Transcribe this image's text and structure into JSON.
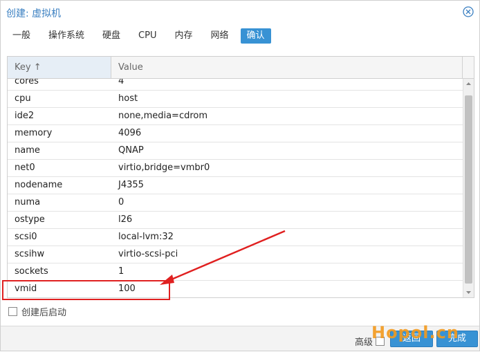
{
  "window": {
    "title": "创建: 虚拟机"
  },
  "tabs": [
    {
      "label": "一般"
    },
    {
      "label": "操作系统"
    },
    {
      "label": "硬盘"
    },
    {
      "label": "CPU"
    },
    {
      "label": "内存"
    },
    {
      "label": "网络"
    },
    {
      "label": "确认",
      "active": true
    }
  ],
  "grid": {
    "columns": {
      "key": "Key ↑",
      "value": "Value"
    },
    "rows": [
      {
        "key": "cores",
        "value": "4"
      },
      {
        "key": "cpu",
        "value": "host"
      },
      {
        "key": "ide2",
        "value": "none,media=cdrom"
      },
      {
        "key": "memory",
        "value": "4096"
      },
      {
        "key": "name",
        "value": "QNAP"
      },
      {
        "key": "net0",
        "value": "virtio,bridge=vmbr0"
      },
      {
        "key": "nodename",
        "value": "J4355"
      },
      {
        "key": "numa",
        "value": "0"
      },
      {
        "key": "ostype",
        "value": "l26"
      },
      {
        "key": "scsi0",
        "value": "local-lvm:32"
      },
      {
        "key": "scsihw",
        "value": "virtio-scsi-pci"
      },
      {
        "key": "sockets",
        "value": "1"
      },
      {
        "key": "vmid",
        "value": "100"
      }
    ]
  },
  "options": {
    "autostart_label": "创建后启动",
    "autostart_checked": false
  },
  "footer": {
    "advanced_label": "高级",
    "back_label": "返回",
    "finish_label": "完成"
  },
  "watermark": {
    "text": "Hopol.cn",
    "color": "#f39a1d"
  },
  "colors": {
    "accent": "#3892d4",
    "title": "#3a7fc1",
    "annotation": "#e02020"
  }
}
